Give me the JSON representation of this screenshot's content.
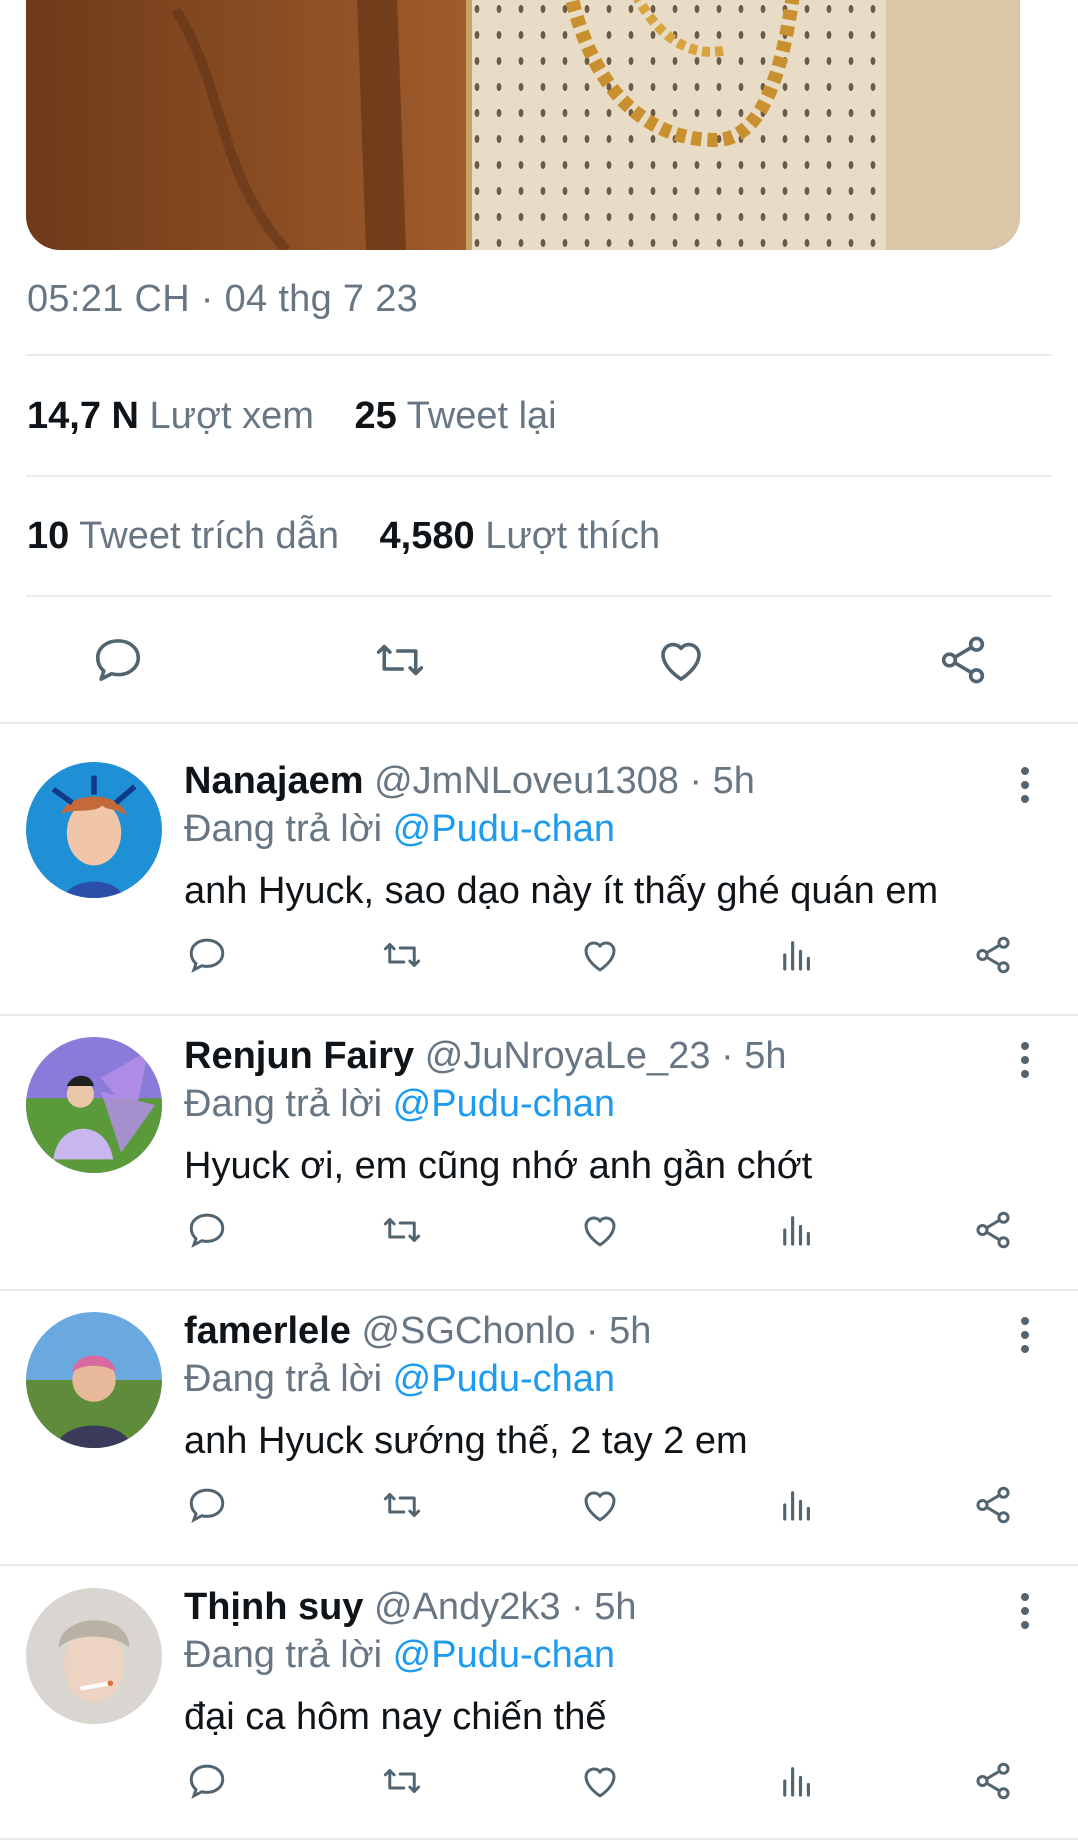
{
  "tweet": {
    "timestamp": "05:21 CH · 04 thg 7 23",
    "views": {
      "count": "14,7 N",
      "label": "Lượt xem"
    },
    "retweets": {
      "count": "25",
      "label": "Tweet lại"
    },
    "quotes": {
      "count": "10",
      "label": "Tweet trích dẫn"
    },
    "likes": {
      "count": "4,580",
      "label": "Lượt thích"
    },
    "actions": {
      "reply": "reply-icon",
      "retweet": "retweet-icon",
      "like": "heart-icon",
      "share": "share-icon"
    }
  },
  "replies": [
    {
      "name": "Nanajaem",
      "handle": "@JmNLoveu1308",
      "time": "5h",
      "replying_label": "Đang trả lời",
      "replying_to": "@Pudu-chan",
      "text": "anh Hyuck, sao dạo này ít thấy ghé quán em"
    },
    {
      "name": "Renjun Fairy",
      "handle": "@JuNroyaLe_23",
      "time": "5h",
      "replying_label": "Đang trả lời",
      "replying_to": "@Pudu-chan",
      "text": "Hyuck ơi, em cũng nhớ anh gần chớt"
    },
    {
      "name": "famerlele",
      "handle": "@SGChonlo",
      "time": "5h",
      "replying_label": "Đang trả lời",
      "replying_to": "@Pudu-chan",
      "text": "anh Hyuck sướng thế, 2 tay 2 em"
    },
    {
      "name": "Thịnh suy",
      "handle": "@Andy2k3",
      "time": "5h",
      "replying_label": "Đang trả lời",
      "replying_to": "@Pudu-chan",
      "text": "đại ca hôm nay chiến thế"
    }
  ],
  "colors": {
    "accent": "#1d9bf0",
    "muted": "#687684",
    "divider": "#e6ecf0"
  }
}
